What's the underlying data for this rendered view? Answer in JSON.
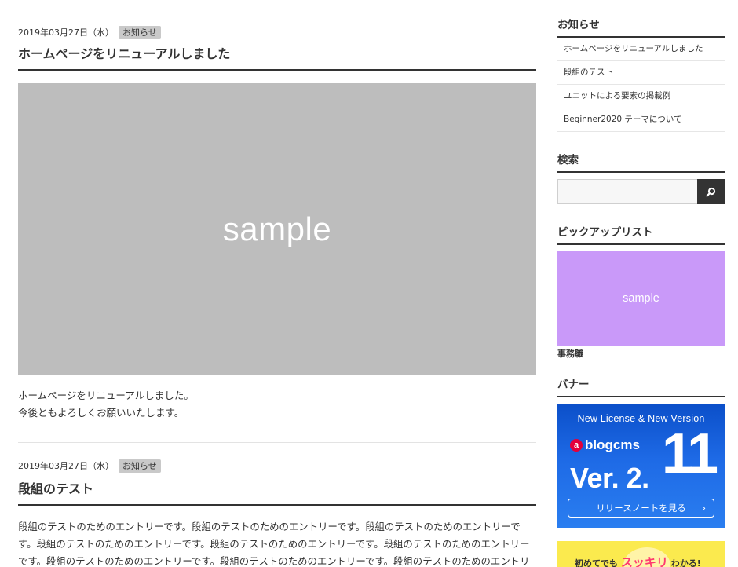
{
  "entries": [
    {
      "date": "2019年03月27日（水）",
      "category": "お知らせ",
      "title": "ホームページをリニューアルしました",
      "image_text": "sample",
      "body": [
        "ホームページをリニューアルしました。",
        "今後ともよろしくお願いいたします。"
      ]
    },
    {
      "date": "2019年03月27日（水）",
      "category": "お知らせ",
      "title": "段組のテスト",
      "body": [
        "段組のテストのためのエントリーです。段組のテストのためのエントリーです。段組のテストのためのエントリーです。段組のテストのためのエントリーです。段組のテストのためのエントリーです。段組のテストのためのエントリーです。段組のテストのためのエントリーです。段組のテストのためのエントリーです。段組のテストのためのエントリーです。段組のテストのため"
      ]
    }
  ],
  "sidebar": {
    "news": {
      "title": "お知らせ",
      "items": [
        "ホームページをリニューアルしました",
        "段組のテスト",
        "ユニットによる要素の掲載例",
        "Beginner2020 テーマについて"
      ]
    },
    "search": {
      "title": "検索",
      "value": "",
      "icon": "search-icon"
    },
    "pickup": {
      "title": "ピックアップリスト",
      "image_text": "sample",
      "caption": "事務職"
    },
    "banner": {
      "title": "バナー",
      "banner1": {
        "top": "New License & New Version",
        "logo_mark": "a",
        "logo": "blogcms",
        "ver": "Ver. 2.",
        "num": "11",
        "cta": "リリースノートを見る"
      },
      "banner2": {
        "pre": "初めてでも",
        "highlight": "スッキリ",
        "post": "わかる!"
      }
    }
  },
  "colors": {
    "image_placeholder": "#bdbdbd",
    "pickup_placeholder": "#c999f9",
    "search_button": "#333333",
    "banner_blue": "#1e6ae6",
    "banner_yellow": "#fbea4e"
  }
}
